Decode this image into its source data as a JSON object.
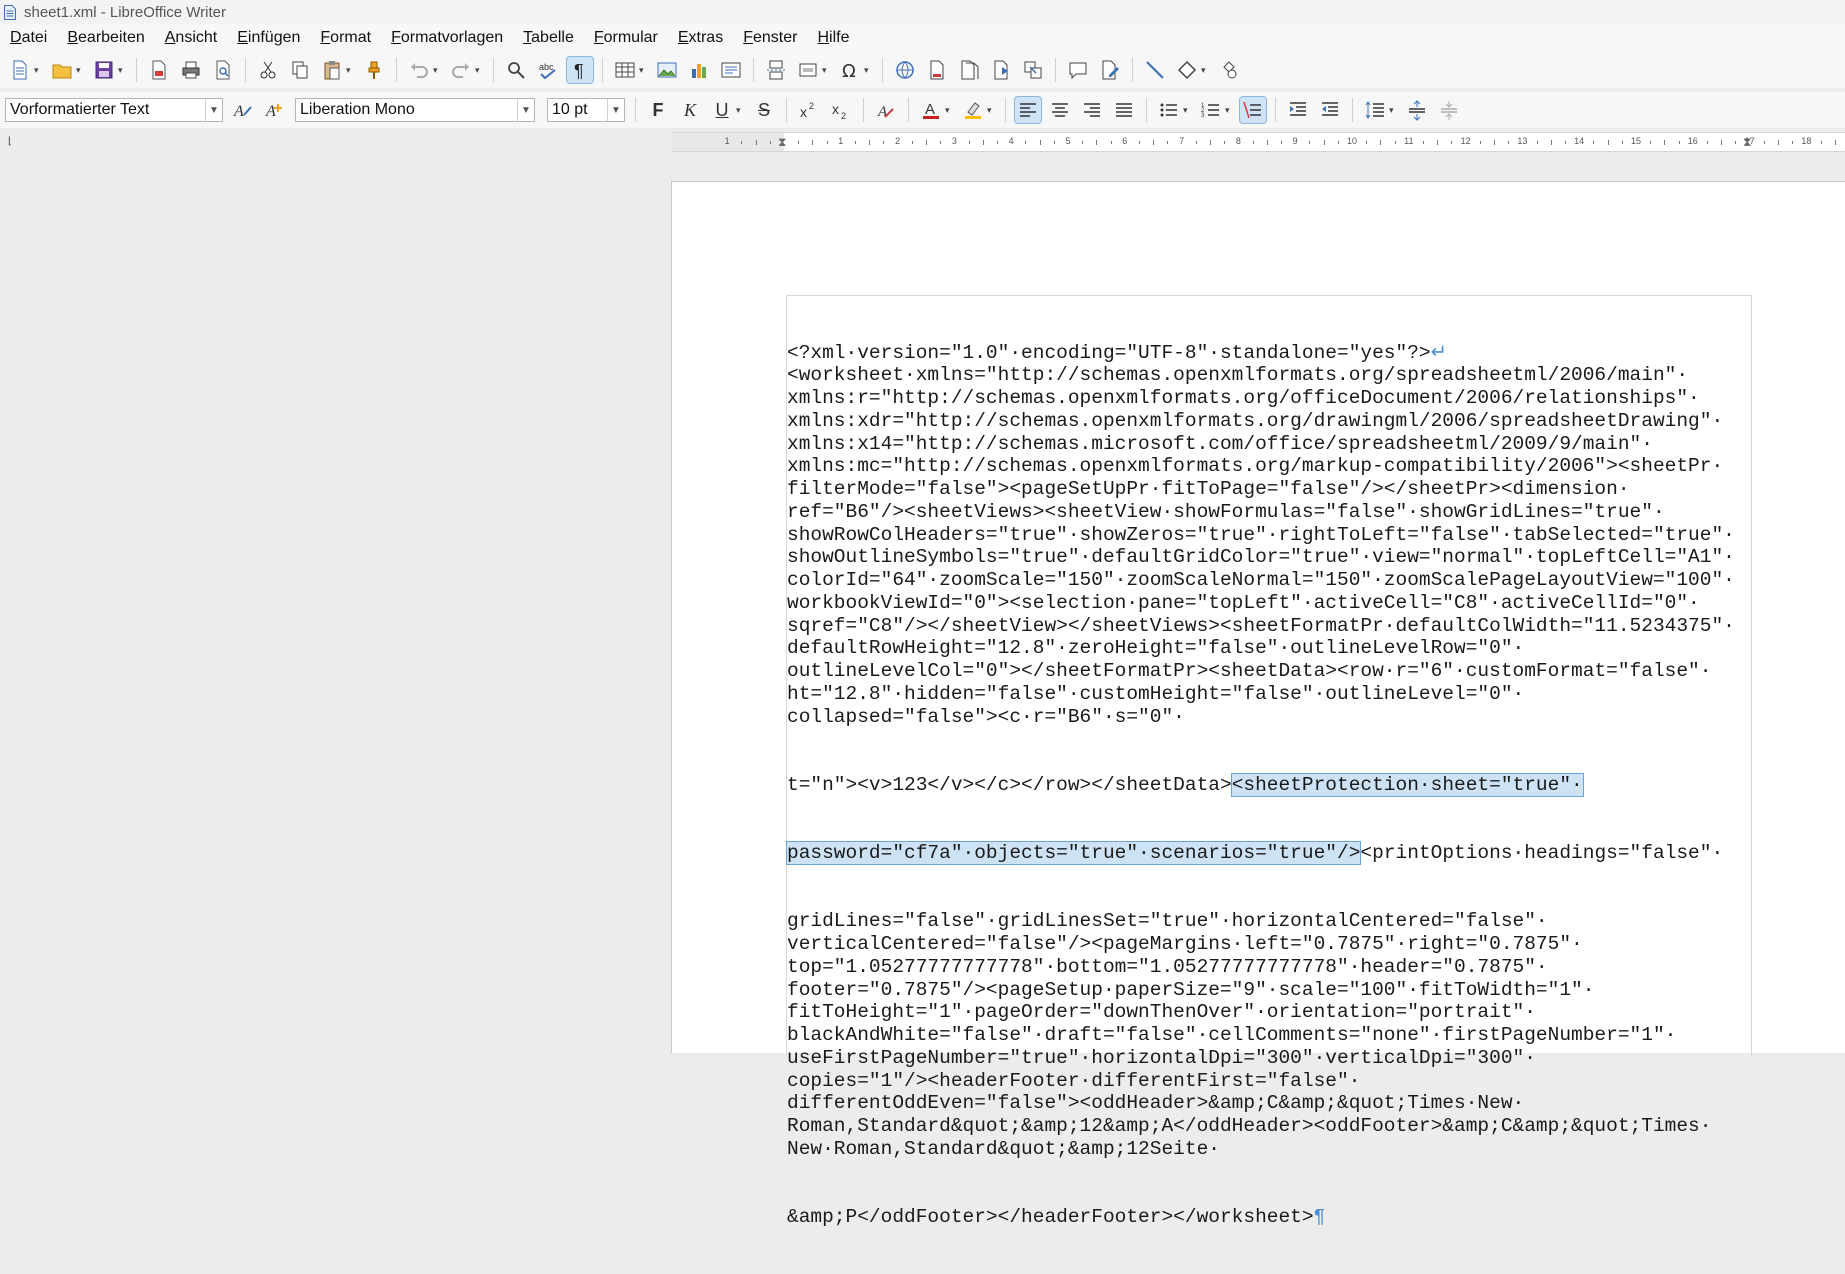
{
  "window": {
    "title": "sheet1.xml - LibreOffice Writer"
  },
  "menu": [
    "Datei",
    "Bearbeiten",
    "Ansicht",
    "Einfügen",
    "Format",
    "Formatvorlagen",
    "Tabelle",
    "Formular",
    "Extras",
    "Fenster",
    "Hilfe"
  ],
  "toolbar2": {
    "paragraph_style": "Vorformatierter Text",
    "font_name": "Liberation Mono",
    "font_size": "10 pt",
    "bold": "F",
    "italic": "K",
    "underline": "U",
    "strike": "S"
  },
  "ruler": {
    "numbers": [
      "1",
      "1",
      "2",
      "3",
      "4",
      "5",
      "6",
      "7",
      "8",
      "9",
      "10",
      "11",
      "12",
      "13",
      "14",
      "15",
      "16",
      "17",
      "18"
    ]
  },
  "document": {
    "lines": [
      "<?xml·version=\"1.0\"·encoding=\"UTF-8\"·standalone=\"yes\"?>",
      "<worksheet·xmlns=\"http://schemas.openxmlformats.org/spreadsheetml/2006/main\"·",
      "xmlns:r=\"http://schemas.openxmlformats.org/officeDocument/2006/relationships\"·",
      "xmlns:xdr=\"http://schemas.openxmlformats.org/drawingml/2006/spreadsheetDrawing\"·",
      "xmlns:x14=\"http://schemas.microsoft.com/office/spreadsheetml/2009/9/main\"·",
      "xmlns:mc=\"http://schemas.openxmlformats.org/markup-compatibility/2006\"><sheetPr·",
      "filterMode=\"false\"><pageSetUpPr·fitToPage=\"false\"/></sheetPr><dimension·",
      "ref=\"B6\"/><sheetViews><sheetView·showFormulas=\"false\"·showGridLines=\"true\"·",
      "showRowColHeaders=\"true\"·showZeros=\"true\"·rightToLeft=\"false\"·tabSelected=\"true\"·",
      "showOutlineSymbols=\"true\"·defaultGridColor=\"true\"·view=\"normal\"·topLeftCell=\"A1\"·",
      "colorId=\"64\"·zoomScale=\"150\"·zoomScaleNormal=\"150\"·zoomScalePageLayoutView=\"100\"·",
      "workbookViewId=\"0\"><selection·pane=\"topLeft\"·activeCell=\"C8\"·activeCellId=\"0\"·",
      "sqref=\"C8\"/></sheetView></sheetViews><sheetFormatPr·defaultColWidth=\"11.5234375\"·",
      "defaultRowHeight=\"12.8\"·zeroHeight=\"false\"·outlineLevelRow=\"0\"·",
      "outlineLevelCol=\"0\"></sheetFormatPr><sheetData><row·r=\"6\"·customFormat=\"false\"·",
      "ht=\"12.8\"·hidden=\"false\"·customHeight=\"false\"·outlineLevel=\"0\"·",
      "collapsed=\"false\"><c·r=\"B6\"·s=\"0\"·"
    ],
    "line18_before": "t=\"n\"><v>123</v></c></row></sheetData>",
    "line18_selected": "<sheetProtection·sheet=\"true\"·",
    "line19_selected": "password=\"cf7a\"·objects=\"true\"·scenarios=\"true\"/>",
    "line19_after": "<printOptions·headings=\"false\"·",
    "lines_after": [
      "gridLines=\"false\"·gridLinesSet=\"true\"·horizontalCentered=\"false\"·",
      "verticalCentered=\"false\"/><pageMargins·left=\"0.7875\"·right=\"0.7875\"·",
      "top=\"1.05277777777778\"·bottom=\"1.05277777777778\"·header=\"0.7875\"·",
      "footer=\"0.7875\"/><pageSetup·paperSize=\"9\"·scale=\"100\"·fitToWidth=\"1\"·",
      "fitToHeight=\"1\"·pageOrder=\"downThenOver\"·orientation=\"portrait\"·",
      "blackAndWhite=\"false\"·draft=\"false\"·cellComments=\"none\"·firstPageNumber=\"1\"·",
      "useFirstPageNumber=\"true\"·horizontalDpi=\"300\"·verticalDpi=\"300\"·",
      "copies=\"1\"/><headerFooter·differentFirst=\"false\"·",
      "differentOddEven=\"false\"><oddHeader>&amp;C&amp;&quot;Times·New·",
      "Roman,Standard&quot;&amp;12&amp;A</oddHeader><oddFooter>&amp;C&amp;&quot;Times·",
      "New·Roman,Standard&quot;&amp;12Seite·"
    ],
    "last_line": "&amp;P</oddFooter></headerFooter></worksheet>",
    "pilcrow": "¶",
    "line_break_mark": "↵"
  }
}
